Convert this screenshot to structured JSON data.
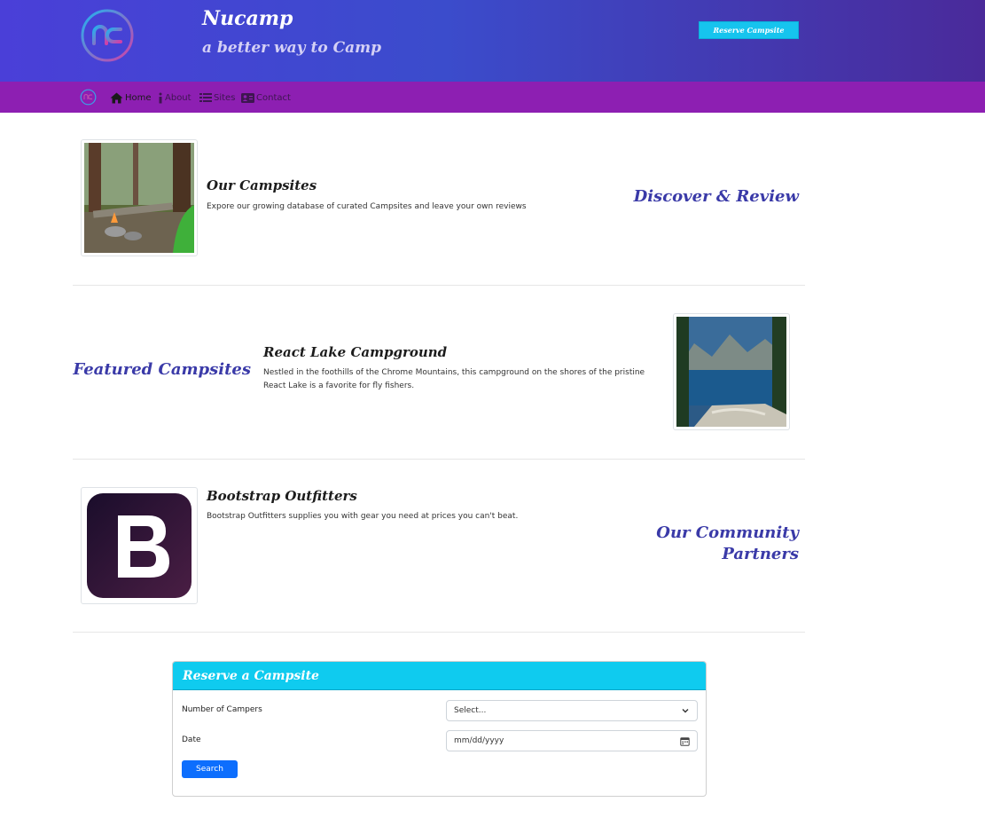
{
  "header": {
    "brand_title": "Nucamp",
    "brand_subtitle": "a better way to Camp",
    "reserve_button": "Reserve Campsite"
  },
  "nav": {
    "items": [
      {
        "label": "Home",
        "icon": "home-icon"
      },
      {
        "label": "About",
        "icon": "info-icon"
      },
      {
        "label": "Sites",
        "icon": "list-icon"
      },
      {
        "label": "Contact",
        "icon": "address-card-icon"
      }
    ]
  },
  "rows": [
    {
      "title": "Our Campsites",
      "text": "Expore our growing database of curated Campsites and leave your own reviews",
      "side_heading": "Discover & Review"
    },
    {
      "title": "React Lake Campground",
      "text_line1": "Nestled in the foothills of the Chrome Mountains, this campground on the shores of the pristine",
      "text_line2": "React Lake is a favorite for fly fishers.",
      "side_heading": "Featured Campsites"
    },
    {
      "title": "Bootstrap Outfitters",
      "text": "Bootstrap Outfitters supplies you with gear you need at prices you can't beat.",
      "side_heading_line1": "Our Community",
      "side_heading_line2": "Partners"
    }
  ],
  "reservation": {
    "title": "Reserve a Campsite",
    "campers_label": "Number of Campers",
    "campers_value": "Select...",
    "date_label": "Date",
    "date_value": "mm/dd/yyyy",
    "search_button": "Search"
  },
  "colors": {
    "header_gradient_start": "#4a3fd8",
    "navbar": "#8d1fb2",
    "accent_cyan": "#0fcbef",
    "heading_blue": "#3a3aa8",
    "primary_button": "#0d6efd"
  }
}
